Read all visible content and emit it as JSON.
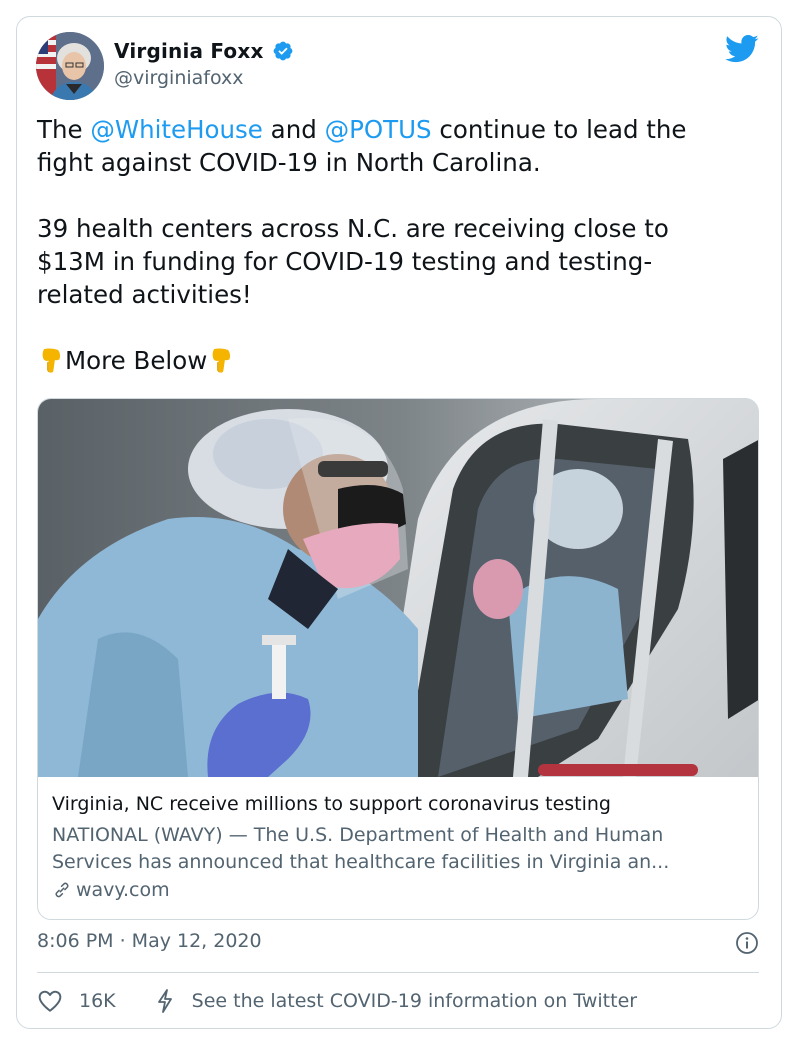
{
  "author": {
    "name": "Virginia Foxx",
    "handle": "@virginiafoxx",
    "verified_icon": "verified-badge-icon",
    "avatar": "profile-photo"
  },
  "brand": {
    "logo": "twitter-bird-icon",
    "accent": "#1d9bf0"
  },
  "tweet": {
    "p1_prefix": "The ",
    "mention_1": "@WhiteHouse",
    "p1_mid": " and ",
    "mention_2": "@POTUS",
    "p1_suffix": " continue to lead the",
    "p1_line2": "fight against COVID-19 in North Carolina.",
    "p2_line1": "39 health centers across N.C. are receiving close to",
    "p2_line2": "$13M in funding for COVID-19 testing and testing-",
    "p2_line3": "related activities!",
    "p3_text": "More Below",
    "emoji": "backhand-index-pointing-down"
  },
  "link_card": {
    "title": "Virginia, NC receive millions to support coronavirus testing",
    "description_line1": "NATIONAL (WAVY) — The U.S. Department of Health and Human",
    "description_line2": "Services has announced that healthcare facilities in Virginia an...",
    "domain": "wavy.com",
    "image": "healthcare-worker-drive-through-covid-testing-photo"
  },
  "meta": {
    "timestamp": "8:06 PM · May 12, 2020",
    "info_icon": "info-icon"
  },
  "footer": {
    "likes": "16K",
    "covid_link": "See the latest COVID-19 information on Twitter"
  },
  "colors": {
    "text": "#0f1419",
    "secondary": "#536471",
    "border": "#cfd9de",
    "link": "#1d9bf0"
  }
}
